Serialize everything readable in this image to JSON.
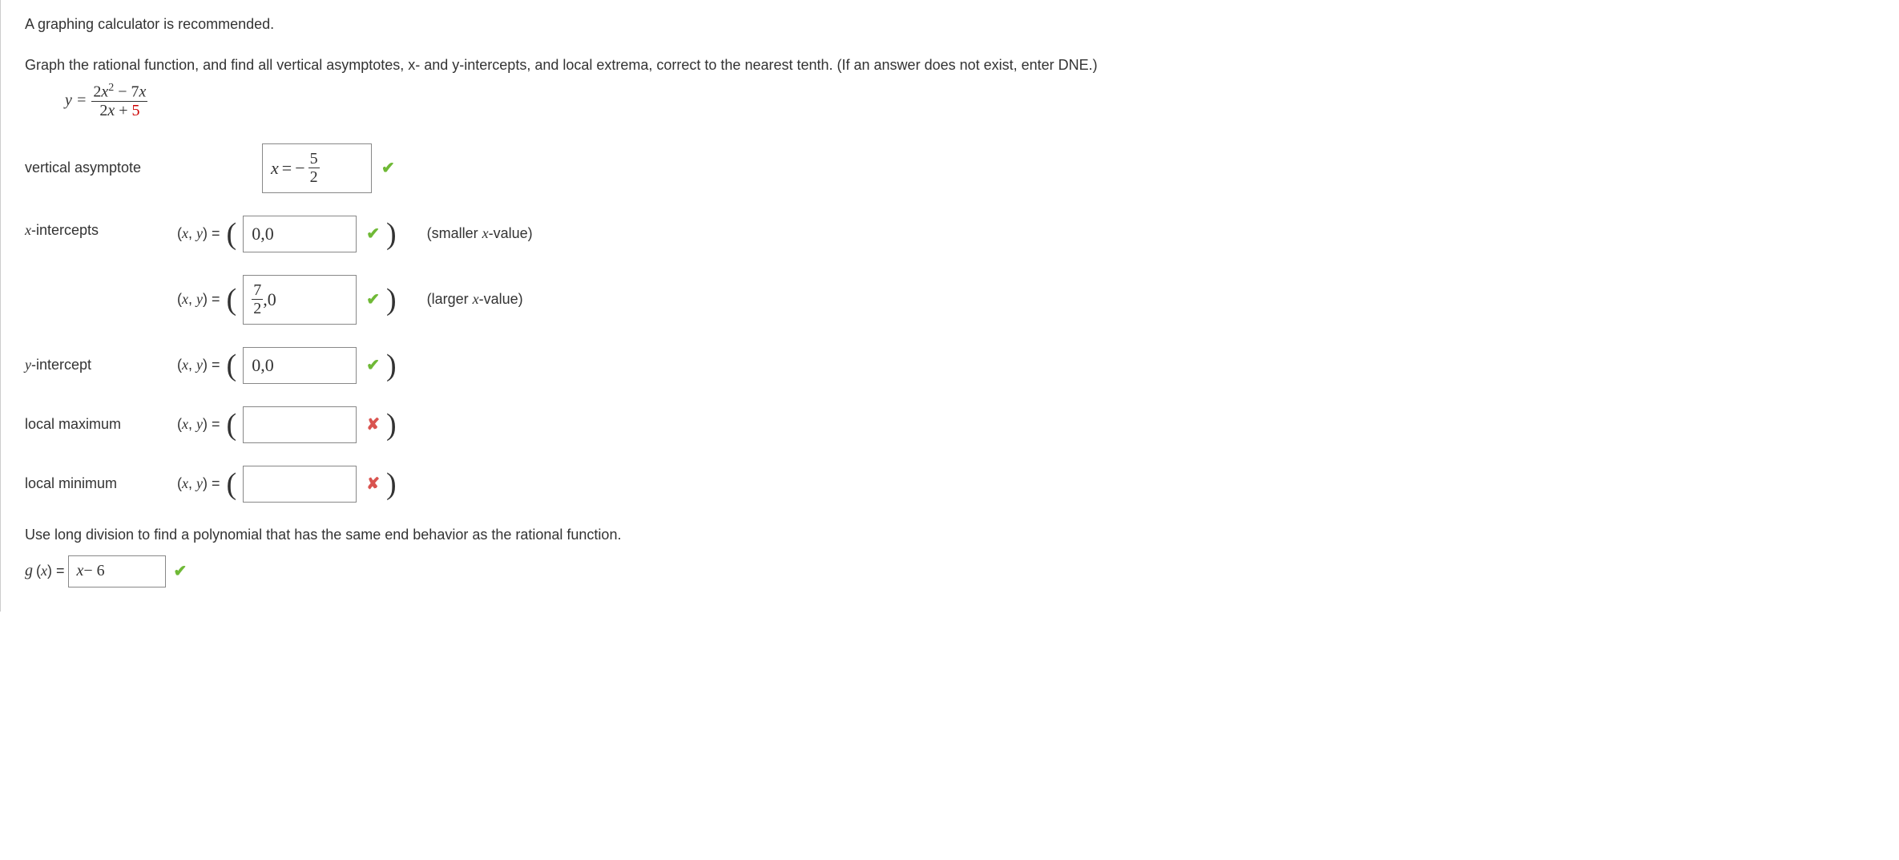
{
  "instruction": "A graphing calculator is recommended.",
  "question": "Graph the rational function, and find all vertical asymptotes, x- and y-intercepts, and local extrema, correct to the nearest tenth. (If an answer does not exist, enter DNE.)",
  "equation": {
    "lhs": "y = ",
    "numerator_pre": "2",
    "numerator_var1": "x",
    "numerator_exp": "2",
    "numerator_mid": " − 7",
    "numerator_var2": "x",
    "denominator_pre": "2",
    "denominator_var": "x",
    "denominator_post": " + ",
    "denominator_const": "5"
  },
  "rows": {
    "vertical_asymptote": {
      "label": "vertical asymptote",
      "answer_prefix": "x = − ",
      "answer_frac_num": "5",
      "answer_frac_den": "2",
      "status": "correct"
    },
    "x_intercepts": {
      "label": "x-intercepts",
      "xy_label": "(x, y) = ",
      "items": [
        {
          "value": "0,0",
          "status": "correct",
          "note": "(smaller x-value)"
        },
        {
          "value_frac_num": "7",
          "value_frac_den": "2",
          "value_suffix": ",0",
          "status": "correct",
          "note": "(larger x-value)"
        }
      ]
    },
    "y_intercept": {
      "label": "y-intercept",
      "xy_label": "(x, y) = ",
      "value": "0,0",
      "status": "correct"
    },
    "local_maximum": {
      "label": "local maximum",
      "xy_label": "(x, y) = ",
      "value": "",
      "status": "wrong"
    },
    "local_minimum": {
      "label": "local minimum",
      "xy_label": "(x, y) = ",
      "value": "",
      "status": "wrong"
    }
  },
  "followup_text": "Use long division to find a polynomial that has the same end behavior as the rational function.",
  "gx": {
    "lhs_var": "g",
    "lhs_paren": "(x) = ",
    "value_var": "x",
    "value_rest": " − 6",
    "status": "correct"
  }
}
